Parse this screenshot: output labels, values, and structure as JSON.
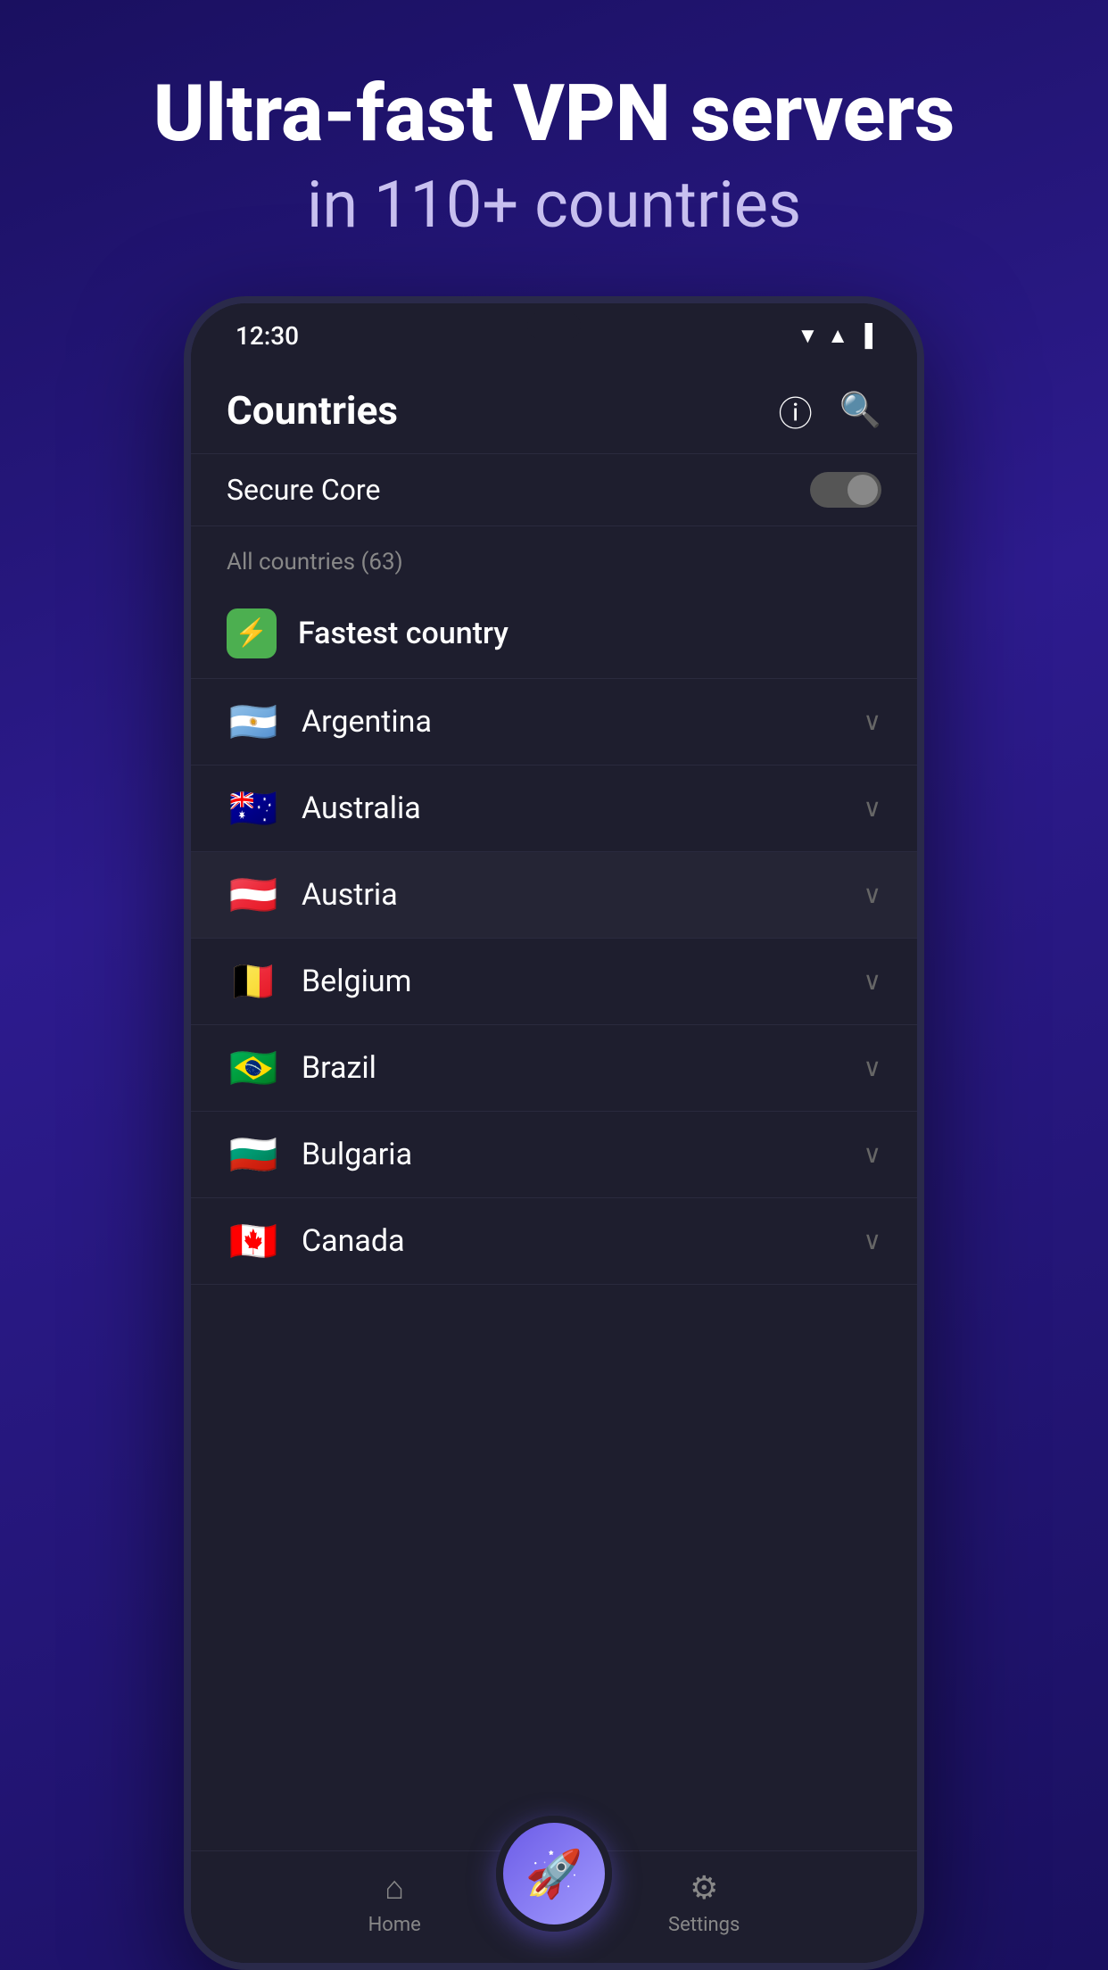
{
  "hero": {
    "title": "Ultra-fast VPN servers",
    "subtitle": "in 110+ countries"
  },
  "statusBar": {
    "time": "12:30"
  },
  "header": {
    "title": "Countries",
    "infoLabel": "ⓘ",
    "searchLabel": "⌕"
  },
  "secureCore": {
    "label": "Secure Core"
  },
  "allCountriesLabel": "All countries (63)",
  "fastestCountry": {
    "label": "Fastest country"
  },
  "countries": [
    {
      "name": "Argentina",
      "flag": "🇦🇷"
    },
    {
      "name": "Australia",
      "flag": "🇦🇺"
    },
    {
      "name": "Austria",
      "flag": "🇦🇹",
      "highlight": true
    },
    {
      "name": "Belgium",
      "flag": "🇧🇪"
    },
    {
      "name": "Brazil",
      "flag": "🇧🇷"
    },
    {
      "name": "Bulgaria",
      "flag": "🇧🇬"
    },
    {
      "name": "Canada",
      "flag": "🇨🇦"
    }
  ],
  "nav": {
    "home": "Home",
    "settings": "Settings",
    "fabIcon": "🚀"
  }
}
